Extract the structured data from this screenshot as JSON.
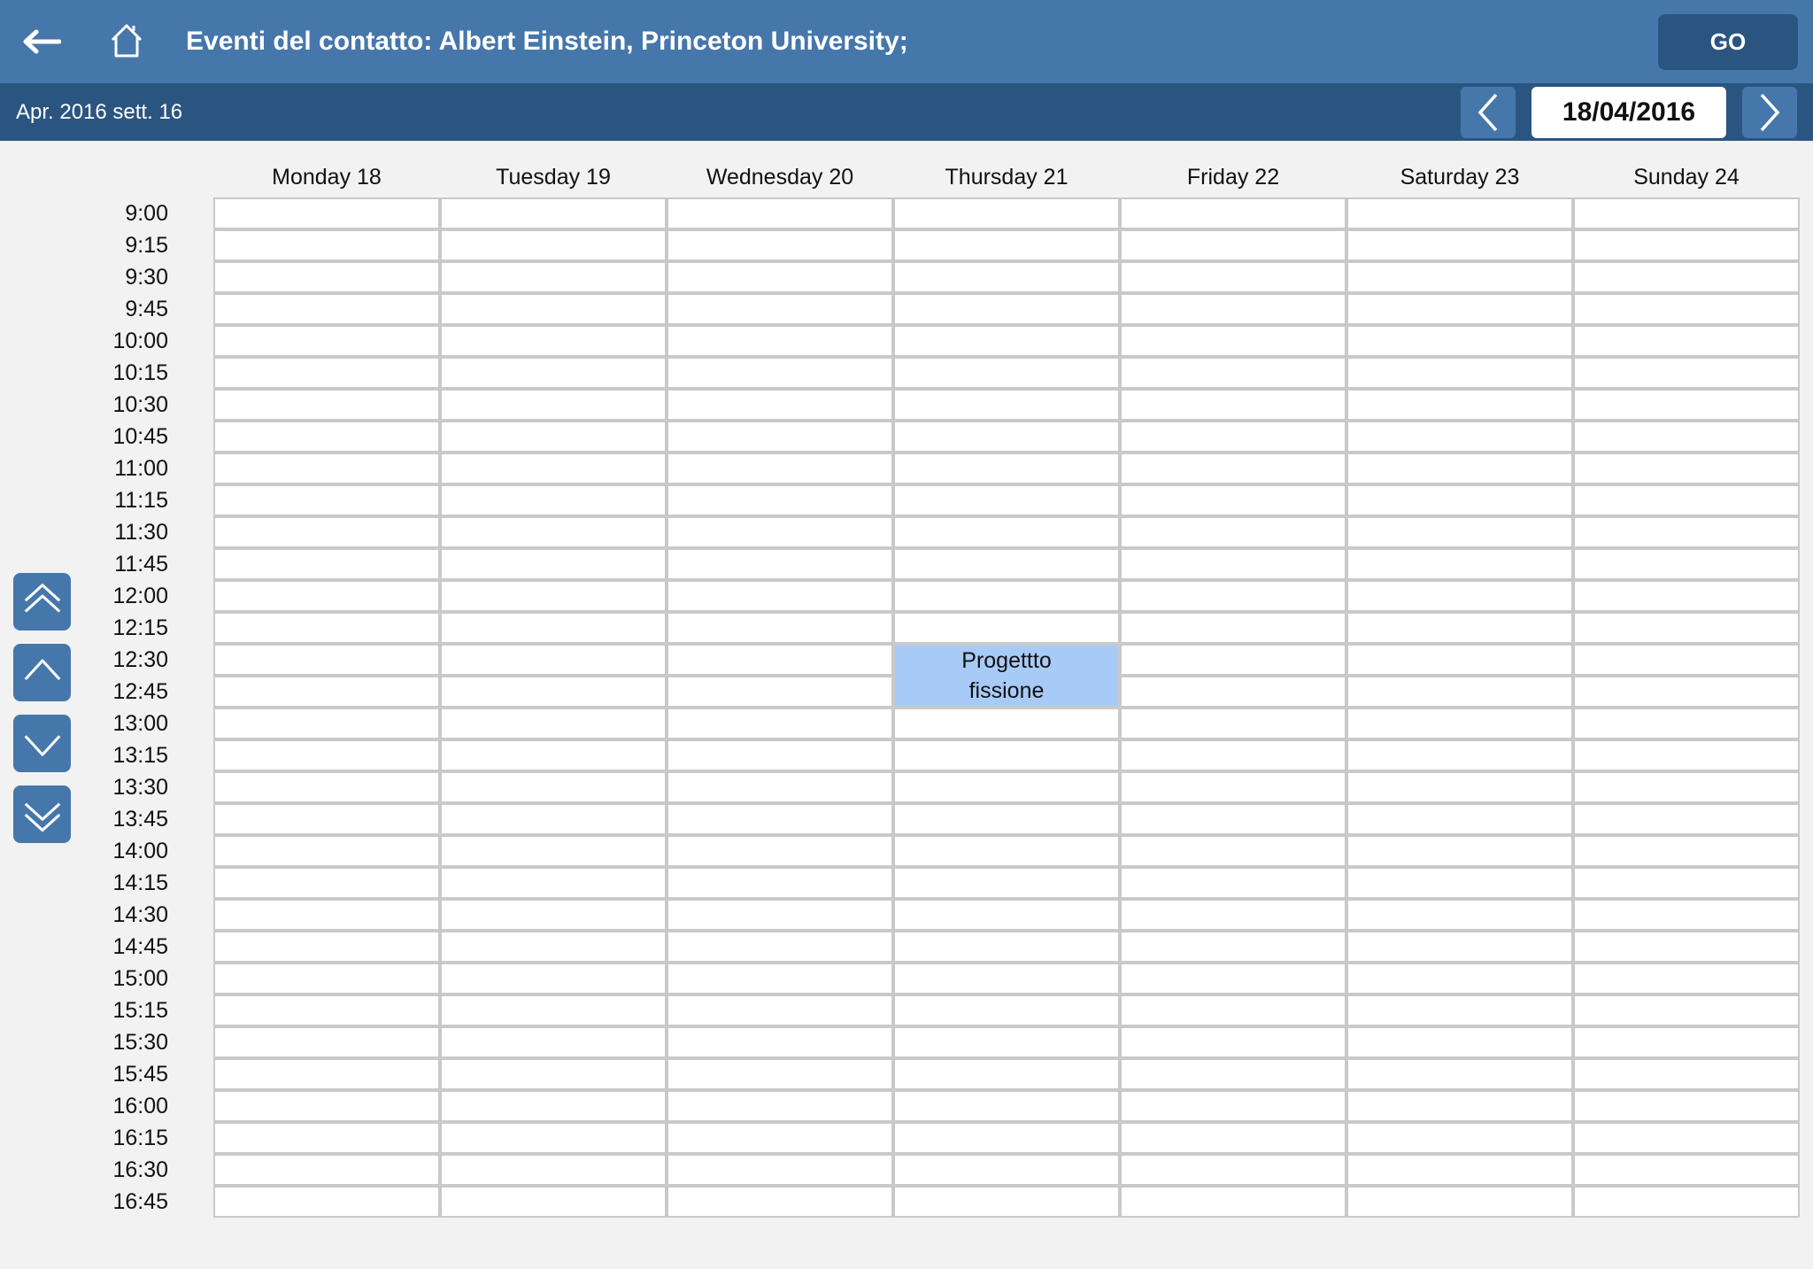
{
  "header": {
    "title": "Eventi del contatto: Albert Einstein, Princeton University;",
    "go_label": "GO",
    "back_icon": "arrow-left-icon",
    "home_icon": "home-icon"
  },
  "subheader": {
    "period": "Apr. 2016 sett. 16",
    "date": "18/04/2016"
  },
  "calendar": {
    "days": [
      "Monday 18",
      "Tuesday 19",
      "Wednesday 20",
      "Thursday 21",
      "Friday 22",
      "Saturday 23",
      "Sunday 24"
    ],
    "times": [
      "9:00",
      "9:15",
      "9:30",
      "9:45",
      "10:00",
      "10:15",
      "10:30",
      "10:45",
      "11:00",
      "11:15",
      "11:30",
      "11:45",
      "12:00",
      "12:15",
      "12:30",
      "12:45",
      "13:00",
      "13:15",
      "13:30",
      "13:45",
      "14:00",
      "14:15",
      "14:30",
      "14:45",
      "15:00",
      "15:15",
      "15:30",
      "15:45",
      "16:00",
      "16:15",
      "16:30",
      "16:45"
    ],
    "events": [
      {
        "day": "Thursday 21",
        "start": "12:30",
        "end": "13:00",
        "lines": [
          "Progettto",
          "fissione"
        ]
      }
    ]
  },
  "scroll_buttons": [
    {
      "name": "scroll-to-top-button",
      "icon": "double-chevron-up-icon"
    },
    {
      "name": "scroll-up-button",
      "icon": "chevron-up-icon"
    },
    {
      "name": "scroll-down-button",
      "icon": "chevron-down-icon"
    },
    {
      "name": "scroll-to-bottom-button",
      "icon": "double-chevron-down-icon"
    }
  ],
  "colors": {
    "topbar": "#4677ab",
    "subbar": "#2b5581",
    "event": "#a7cbf6",
    "grid_border": "#c9c9c9"
  }
}
